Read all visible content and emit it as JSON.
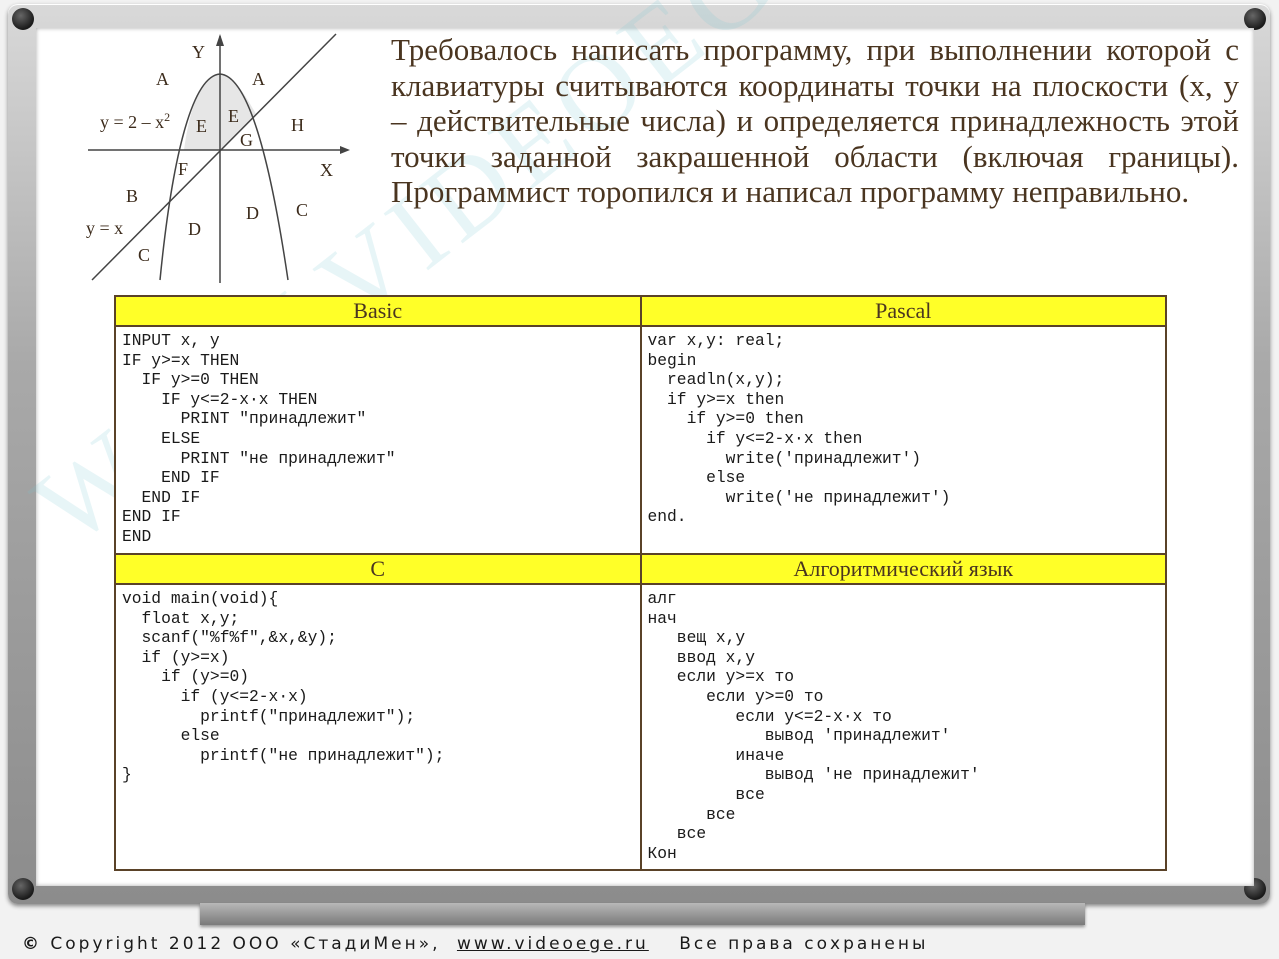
{
  "watermark": "WWW.VIDEOEGE.RU",
  "graph": {
    "axis_y": "Y",
    "axis_x": "X",
    "parabola_label_main": "y = 2 – x",
    "parabola_label_exp": "2",
    "line_label": "y = x",
    "regions": [
      "A",
      "A",
      "E",
      "E",
      "G",
      "H",
      "F",
      "B",
      "D",
      "D",
      "C",
      "C"
    ]
  },
  "problem_text": "Требовалось написать программу, при выполнении которой с клавиатуры считываются координаты точки на плоскости (x, y – действительные числа) и определяется принадлежность этой точки заданной закрашенной области (включая границы). Программист торопился и написал программу неправильно.",
  "table": {
    "headers": [
      "Basic",
      "Pascal",
      "C",
      "Алгоритмический язык"
    ],
    "basic": "INPUT x, y\nIF y>=x THEN\n  IF y>=0 THEN\n    IF y<=2-x·x THEN\n      PRINT \"принадлежит\"\n    ELSE\n      PRINT \"не принадлежит\"\n    END IF\n  END IF\nEND IF\nEND",
    "pascal": "var x,y: real;\nbegin\n  readln(x,y);\n  if y>=x then\n    if y>=0 then\n      if y<=2-x·x then\n        write('принадлежит')\n      else\n        write('не принадлежит')\nend.",
    "c": "void main(void){\n  float x,y;\n  scanf(\"%f%f\",&x,&y);\n  if (y>=x)\n    if (y>=0)\n      if (y<=2-x·x)\n        printf(\"принадлежит\");\n      else\n        printf(\"не принадлежит\");\n}",
    "alg": "алг\nнач\n   вещ x,y\n   ввод x,y\n   если y>=x то\n      если y>=0 то\n         если y<=2-x·x то\n            вывод 'принадлежит'\n         иначе\n            вывод 'не принадлежит'\n         все\n      все\n   все\nКон"
  },
  "footer": {
    "copyright": "Copyright 2012 ООО «СтадиМен»,",
    "site": "www.videoege.ru",
    "rights": "Все права сохранены"
  },
  "colors": {
    "header_bg": "#ffff28",
    "text_brown": "#4a3520",
    "shaded_region": "#e6e6e6"
  }
}
